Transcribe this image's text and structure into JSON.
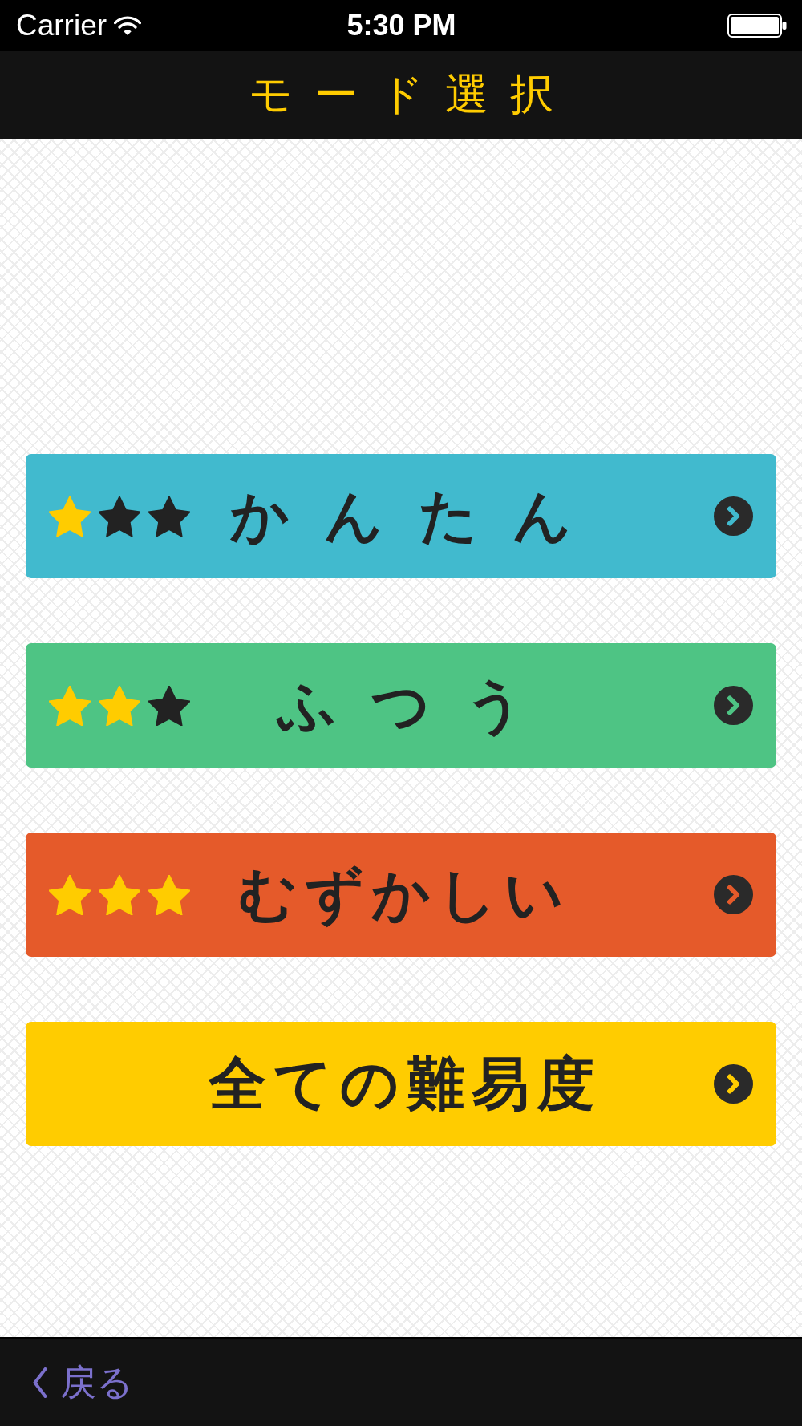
{
  "status_bar": {
    "carrier": "Carrier",
    "time": "5:30 PM"
  },
  "nav_bar": {
    "title": "モ ー ド 選 択"
  },
  "modes": [
    {
      "label": "か ん た ん",
      "stars": 1,
      "color": "#41bace"
    },
    {
      "label": "ふ つ う",
      "stars": 2,
      "color": "#4ec484"
    },
    {
      "label": "むずかしい",
      "stars": 3,
      "color": "#e55a2a"
    },
    {
      "label": "全ての難易度",
      "color": "#ffcc00"
    }
  ],
  "toolbar": {
    "back": "戻る"
  }
}
